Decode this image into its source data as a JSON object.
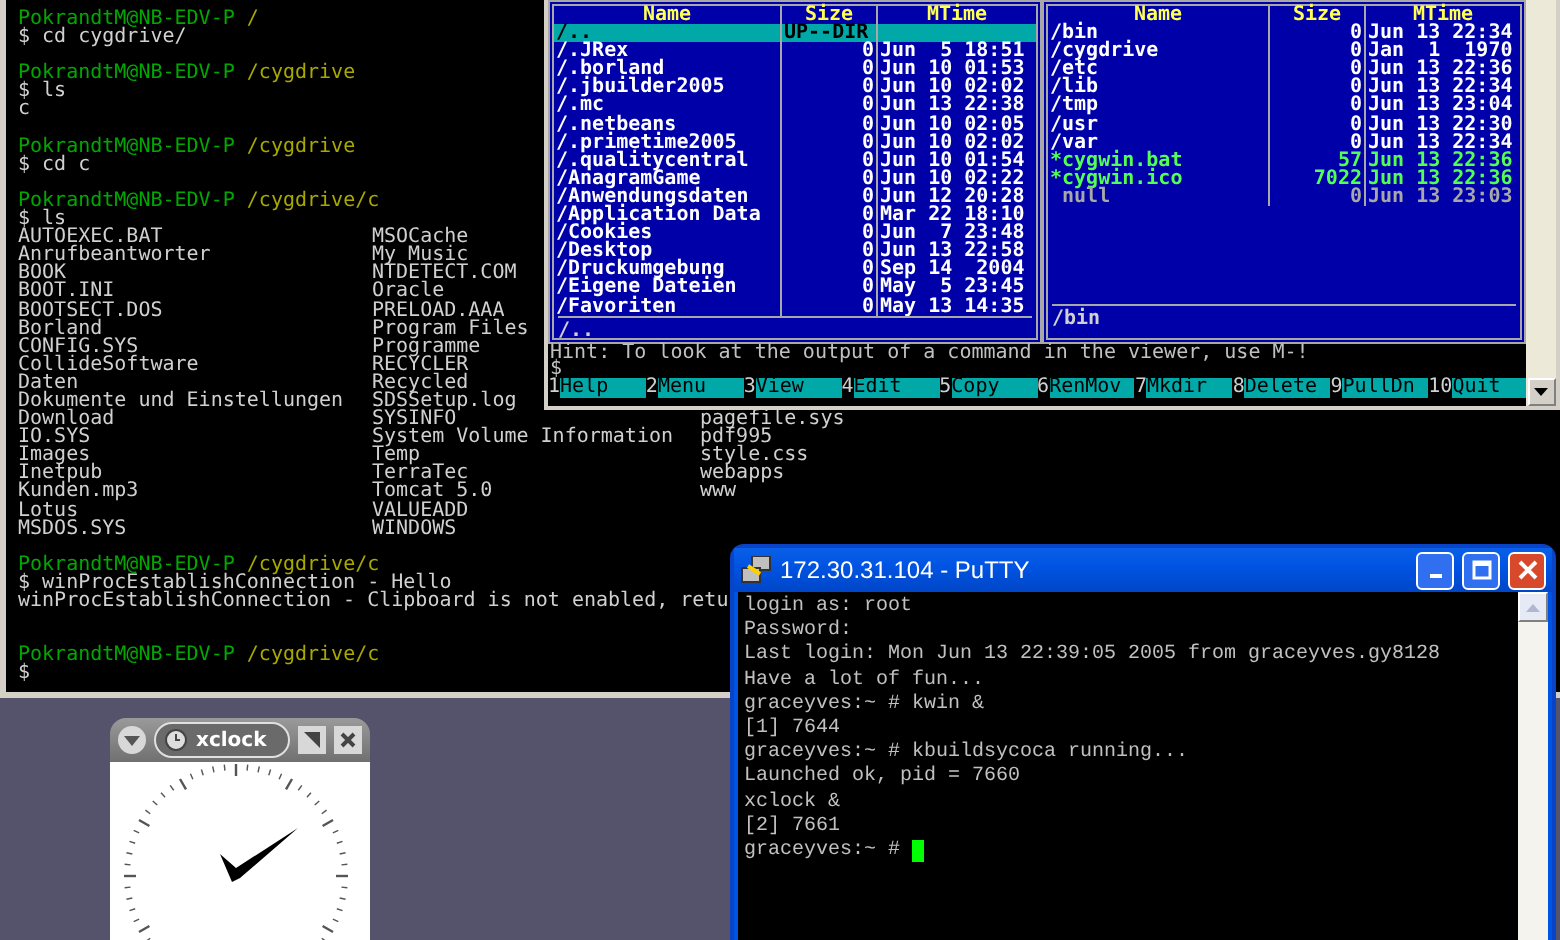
{
  "terminal": {
    "lines": [
      {
        "kind": "prompt",
        "user": "PokrandtM@NB-EDV-P",
        "path": "/"
      },
      {
        "kind": "text",
        "text": "$ cd cygdrive/"
      },
      {
        "kind": "blank"
      },
      {
        "kind": "prompt",
        "user": "PokrandtM@NB-EDV-P",
        "path": "/cygdrive"
      },
      {
        "kind": "text",
        "text": "$ ls"
      },
      {
        "kind": "text",
        "text": "c"
      },
      {
        "kind": "blank"
      },
      {
        "kind": "prompt",
        "user": "PokrandtM@NB-EDV-P",
        "path": "/cygdrive"
      },
      {
        "kind": "text",
        "text": "$ cd c"
      },
      {
        "kind": "blank"
      },
      {
        "kind": "prompt",
        "user": "PokrandtM@NB-EDV-P",
        "path": "/cygdrive/c"
      },
      {
        "kind": "text",
        "text": "$ ls"
      },
      {
        "kind": "columns",
        "cells": [
          "AUTOEXEC.BAT",
          "MSOCache"
        ]
      },
      {
        "kind": "columns",
        "cells": [
          "Anrufbeantworter",
          "My Music"
        ]
      },
      {
        "kind": "columns",
        "cells": [
          "BOOK",
          "NTDETECT.COM"
        ]
      },
      {
        "kind": "columns",
        "cells": [
          "BOOT.INI",
          "Oracle"
        ]
      },
      {
        "kind": "columns",
        "cells": [
          "BOOTSECT.DOS",
          "PRELOAD.AAA"
        ]
      },
      {
        "kind": "columns",
        "cells": [
          "Borland",
          "Program Files"
        ]
      },
      {
        "kind": "columns",
        "cells": [
          "CONFIG.SYS",
          "Programme"
        ]
      },
      {
        "kind": "columns",
        "cells": [
          "CollideSoftware",
          "RECYCLER"
        ]
      },
      {
        "kind": "columns",
        "cells": [
          "Daten",
          "Recycled"
        ]
      },
      {
        "kind": "columns",
        "cells": [
          "Dokumente und Einstellungen",
          "SDSSetup.log"
        ]
      },
      {
        "kind": "columns",
        "cells": [
          "Download",
          "SYSINFO",
          "pagefile.sys"
        ]
      },
      {
        "kind": "columns",
        "cells": [
          "IO.SYS",
          "System Volume Information",
          "pdf995"
        ]
      },
      {
        "kind": "columns",
        "cells": [
          "Images",
          "Temp",
          "style.css"
        ]
      },
      {
        "kind": "columns",
        "cells": [
          "Inetpub",
          "TerraTec",
          "webapps"
        ]
      },
      {
        "kind": "columns",
        "cells": [
          "Kunden.mp3",
          "Tomcat 5.0",
          "www"
        ]
      },
      {
        "kind": "columns",
        "cells": [
          "Lotus",
          "VALUEADD"
        ]
      },
      {
        "kind": "columns",
        "cells": [
          "MSDOS.SYS",
          "WINDOWS"
        ]
      },
      {
        "kind": "blank"
      },
      {
        "kind": "prompt",
        "user": "PokrandtM@NB-EDV-P",
        "path": "/cygdrive/c"
      },
      {
        "kind": "text",
        "text": "$ winProcEstablishConnection - Hello"
      },
      {
        "kind": "text",
        "text": "winProcEstablishConnection - Clipboard is not enabled, retu"
      },
      {
        "kind": "blank"
      },
      {
        "kind": "blank"
      },
      {
        "kind": "prompt",
        "user": "PokrandtM@NB-EDV-P",
        "path": "/cygdrive/c"
      },
      {
        "kind": "text",
        "text": "$"
      }
    ]
  },
  "file_manager": {
    "left_panel": {
      "columns": [
        "Name",
        "Size",
        "MTime"
      ],
      "footer": "/..",
      "rows": [
        {
          "name": "/..",
          "size": "UP--DIR",
          "kind": "dir",
          "selected": true
        },
        {
          "name": "/.JRex",
          "size": "0",
          "time": "Jun  5 18:51",
          "kind": "dir",
          "selected": false
        },
        {
          "name": "/.borland",
          "size": "0",
          "time": "Jun 10 01:53",
          "kind": "dir",
          "selected": false
        },
        {
          "name": "/.jbuilder2005",
          "size": "0",
          "time": "Jun 10 02:02",
          "kind": "dir",
          "selected": false
        },
        {
          "name": "/.mc",
          "size": "0",
          "time": "Jun 13 22:38",
          "kind": "dir",
          "selected": false
        },
        {
          "name": "/.netbeans",
          "size": "0",
          "time": "Jun 10 02:05",
          "kind": "dir",
          "selected": false
        },
        {
          "name": "/.primetime2005",
          "size": "0",
          "time": "Jun 10 02:02",
          "kind": "dir",
          "selected": false
        },
        {
          "name": "/.qualitycentral",
          "size": "0",
          "time": "Jun 10 01:54",
          "kind": "dir",
          "selected": false
        },
        {
          "name": "/AnagramGame",
          "size": "0",
          "time": "Jun 10 02:22",
          "kind": "dir",
          "selected": false
        },
        {
          "name": "/Anwendungsdaten",
          "size": "0",
          "time": "Jun 12 20:28",
          "kind": "dir",
          "selected": false
        },
        {
          "name": "/Application Data",
          "size": "0",
          "time": "Mar 22 18:10",
          "kind": "dir",
          "selected": false
        },
        {
          "name": "/Cookies",
          "size": "0",
          "time": "Jun  7 23:48",
          "kind": "dir",
          "selected": false
        },
        {
          "name": "/Desktop",
          "size": "0",
          "time": "Jun 13 22:58",
          "kind": "dir",
          "selected": false
        },
        {
          "name": "/Druckumgebung",
          "size": "0",
          "time": "Sep 14  2004",
          "kind": "dir",
          "selected": false
        },
        {
          "name": "/Eigene Dateien",
          "size": "0",
          "time": "May  5 23:45",
          "kind": "dir",
          "selected": false
        },
        {
          "name": "/Favoriten",
          "size": "0",
          "time": "May 13 14:35",
          "kind": "dir",
          "selected": false
        }
      ]
    },
    "right_panel": {
      "columns": [
        "Name",
        "Size",
        "MTime"
      ],
      "footer": "/bin",
      "rows": [
        {
          "name": "/bin",
          "size": "0",
          "time": "Jun 13 22:34",
          "kind": "dir",
          "selected": false
        },
        {
          "name": "/cygdrive",
          "size": "0",
          "time": "Jan  1  1970",
          "kind": "dir",
          "selected": false
        },
        {
          "name": "/etc",
          "size": "0",
          "time": "Jun 13 22:36",
          "kind": "dir",
          "selected": false
        },
        {
          "name": "/lib",
          "size": "0",
          "time": "Jun 13 22:34",
          "kind": "dir",
          "selected": false
        },
        {
          "name": "/tmp",
          "size": "0",
          "time": "Jun 13 23:04",
          "kind": "dir",
          "selected": false
        },
        {
          "name": "/usr",
          "size": "0",
          "time": "Jun 13 22:30",
          "kind": "dir",
          "selected": false
        },
        {
          "name": "/var",
          "size": "0",
          "time": "Jun 13 22:34",
          "kind": "dir",
          "selected": false
        },
        {
          "name": "*cygwin.bat",
          "size": "57",
          "time": "Jun 13 22:36",
          "kind": "exec",
          "selected": false
        },
        {
          "name": "*cygwin.ico",
          "size": "7022",
          "time": "Jun 13 22:36",
          "kind": "exec",
          "selected": false
        },
        {
          "name": " null",
          "size": "0",
          "time": "Jun 13 23:03",
          "kind": "file",
          "selected": false
        }
      ]
    },
    "hint": "Hint: To look at the output of a command in the viewer, use M-!",
    "command_line": "$",
    "function_keys": [
      {
        "number": "1",
        "label": "Help"
      },
      {
        "number": "2",
        "label": "Menu"
      },
      {
        "number": "3",
        "label": "View"
      },
      {
        "number": "4",
        "label": "Edit"
      },
      {
        "number": "5",
        "label": "Copy"
      },
      {
        "number": "6",
        "label": "RenMov"
      },
      {
        "number": "7",
        "label": "Mkdir"
      },
      {
        "number": "8",
        "label": "Delete"
      },
      {
        "number": "9",
        "label": "PullDn"
      },
      {
        "number": "10",
        "label": "Quit"
      }
    ]
  },
  "putty": {
    "title": "172.30.31.104 - PuTTY",
    "lines": [
      "login as: root",
      "Password:",
      "Last login: Mon Jun 13 22:39:05 2005 from graceyves.gy8128",
      "Have a lot of fun...",
      "graceyves:~ # kwin &",
      "[1] 7644",
      "graceyves:~ # kbuildsycoca running...",
      "Launched ok, pid = 7660",
      "xclock &",
      "[2] 7661",
      "graceyves:~ #"
    ]
  },
  "xclock": {
    "title": "xclock"
  }
}
